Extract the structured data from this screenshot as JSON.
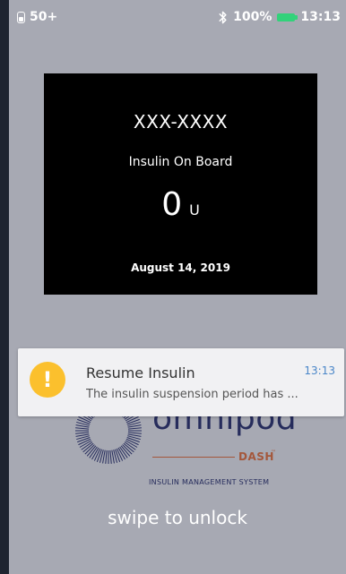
{
  "status_bar": {
    "notification_count": "50+",
    "battery_percent": "100%",
    "time": "13:13",
    "icons": [
      "notification-count-icon",
      "bluetooth-icon",
      "battery-icon"
    ]
  },
  "iob_card": {
    "pod_id": "XXX-XXXX",
    "label": "Insulin On Board",
    "value": "0",
    "unit": "U",
    "date": "August 14, 2019"
  },
  "logo": {
    "word": "omnipod",
    "registered": "®",
    "product": "DASH",
    "trademark": "™",
    "tagline": "INSULIN MANAGEMENT SYSTEM",
    "colors": {
      "navy": "#262c5c",
      "copper": "#a4573b"
    }
  },
  "notification": {
    "icon": "exclamation-icon",
    "icon_glyph": "!",
    "title": "Resume Insulin",
    "time": "13:13",
    "body": "The insulin suspension period has ..."
  },
  "swipe_text": "swipe to unlock",
  "colors": {
    "screen_bg": "#a7a9b3",
    "bezel": "#1e2430",
    "battery": "#32d27a",
    "warning": "#fbc02d",
    "link_blue": "#4a86c8"
  }
}
